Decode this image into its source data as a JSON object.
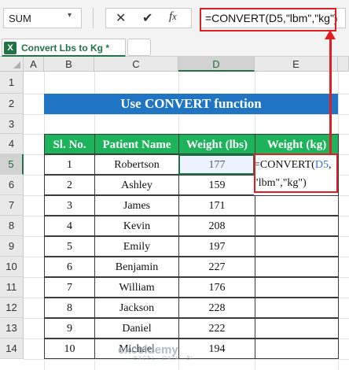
{
  "formula_bar": {
    "name_box": "SUM",
    "cancel_icon": "close-icon",
    "enter_icon": "check-icon",
    "function_icon": "fx-icon",
    "formula": "=CONVERT(D5,\"lbm\",\"kg\")"
  },
  "sheet_tabs": [
    {
      "label": "Convert Lbs to Kg *",
      "active": true
    }
  ],
  "columns": [
    "A",
    "B",
    "C",
    "D",
    "E"
  ],
  "selected_column": "D",
  "rows": [
    "1",
    "2",
    "3",
    "4",
    "5",
    "6",
    "7",
    "8",
    "9",
    "10",
    "11",
    "12",
    "13",
    "14"
  ],
  "selected_row": "5",
  "title_banner": "Use CONVERT function",
  "table": {
    "headers": [
      "Sl. No.",
      "Patient Name",
      "Weight (lbs)",
      "Weight (kg)"
    ],
    "rows": [
      [
        "1",
        "Robertson",
        "177"
      ],
      [
        "2",
        "Ashley",
        "159"
      ],
      [
        "3",
        "James",
        "171"
      ],
      [
        "4",
        "Kevin",
        "208"
      ],
      [
        "5",
        "Emily",
        "197"
      ],
      [
        "6",
        "Benjamin",
        "227"
      ],
      [
        "7",
        "William",
        "176"
      ],
      [
        "8",
        "Jackson",
        "228"
      ],
      [
        "9",
        "Daniel",
        "222"
      ],
      [
        "10",
        "Michael",
        "194"
      ]
    ]
  },
  "edit_cell": {
    "line1_prefix": "=CONVERT(",
    "line1_ref": "D5",
    "line1_suffix": ",",
    "line2": "\"lbm\",\"kg\")"
  },
  "watermark": {
    "title": "exceldemy",
    "subtitle": "EXCEL · DATA · BI"
  },
  "colors": {
    "accent": "#217346",
    "banner": "#1f74c4",
    "header_green": "#1db35a",
    "highlight_red": "#e02020"
  }
}
